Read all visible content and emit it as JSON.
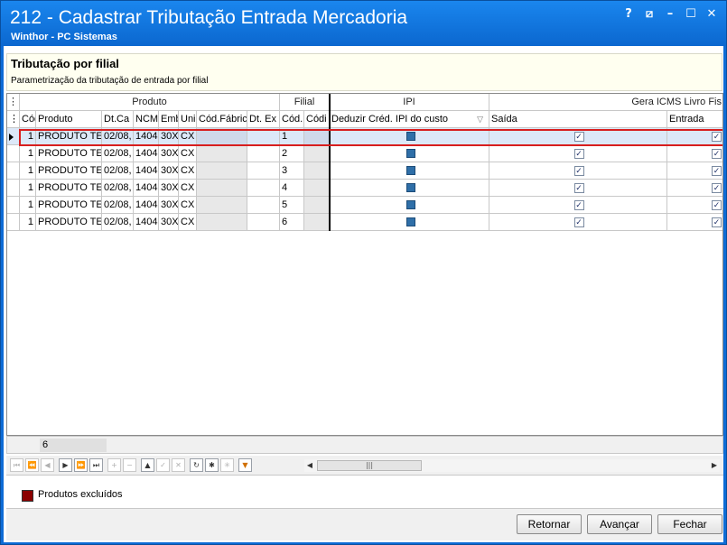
{
  "window": {
    "title": "212 - Cadastrar Tributação Entrada Mercadoria",
    "subtitle": "Winthor - PC Sistemas",
    "controls": {
      "help": "?",
      "restore": "⧄",
      "minimize": "–",
      "maximize": "☐",
      "close": "✕"
    }
  },
  "panel": {
    "title": "Tributação por filial",
    "description": "Parametrização da tributação de entrada por filial"
  },
  "grid": {
    "bands": [
      "Produto",
      "Filial",
      "IPI",
      "Gera ICMS Livro Fis"
    ],
    "columns": [
      "Cód",
      "Produto",
      "Dt.Ca",
      "NCM",
      "Emb",
      "Uni",
      "Cód.Fábric",
      "Dt. Ex",
      "Cód.",
      "Códi",
      "Deduzir Créd. IPI do custo",
      "Saída",
      "Entrada"
    ],
    "rows": [
      {
        "cod": "1",
        "produto": "PRODUTO TES",
        "dtca": "02/08,",
        "ncm": "1404",
        "emb": "30X",
        "uni": "CX",
        "filial": "1"
      },
      {
        "cod": "1",
        "produto": "PRODUTO TES",
        "dtca": "02/08,",
        "ncm": "1404",
        "emb": "30X",
        "uni": "CX",
        "filial": "2"
      },
      {
        "cod": "1",
        "produto": "PRODUTO TES",
        "dtca": "02/08,",
        "ncm": "1404",
        "emb": "30X",
        "uni": "CX",
        "filial": "3"
      },
      {
        "cod": "1",
        "produto": "PRODUTO TES",
        "dtca": "02/08,",
        "ncm": "1404",
        "emb": "30X",
        "uni": "CX",
        "filial": "4"
      },
      {
        "cod": "1",
        "produto": "PRODUTO TES",
        "dtca": "02/08,",
        "ncm": "1404",
        "emb": "30X",
        "uni": "CX",
        "filial": "5"
      },
      {
        "cod": "1",
        "produto": "PRODUTO TES",
        "dtca": "02/08,",
        "ncm": "1404",
        "emb": "30X",
        "uni": "CX",
        "filial": "6"
      }
    ],
    "row_count": "6",
    "selection_color": "#d81e1e"
  },
  "legend": {
    "label": "Produtos excluídos",
    "color": "#8b0000"
  },
  "buttons": {
    "retornar": "Retornar",
    "avancar": "Avançar",
    "fechar": "Fechar"
  }
}
